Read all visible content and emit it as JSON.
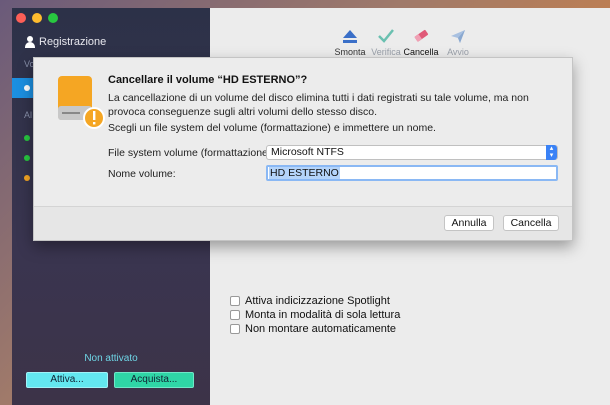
{
  "sidebar": {
    "registration_label": "Registrazione",
    "section_volumes": "Vo",
    "section_other": "Al",
    "status_text": "Non attivato",
    "activate_label": "Attiva...",
    "buy_label": "Acquista...",
    "dot_colors": [
      "#28c840",
      "#28c840",
      "#f5a623"
    ]
  },
  "toolbar": {
    "unmount_label": "Smonta",
    "verify_label": "Verifica",
    "erase_label": "Cancella",
    "launch_label": "Avvio"
  },
  "options": {
    "spotlight_label": "Attiva indicizzazione Spotlight",
    "readonly_label": "Monta in modalità di sola lettura",
    "nomount_label": "Non montare automaticamente"
  },
  "sheet": {
    "title": "Cancellare il volume “HD ESTERNO”?",
    "description": "La cancellazione di un volume del disco elimina tutti i dati registrati su tale volume, ma non provoca conseguenze sugli altri volumi dello stesso disco.",
    "subtitle": "Scegli un file system del volume (formattazione) e immettere un nome.",
    "fs_label": "File system volume (formattazione):",
    "fs_value": "Microsoft NTFS",
    "name_label": "Nome volume:",
    "name_value": "HD ESTERNO",
    "cancel_label": "Annulla",
    "erase_label": "Cancella"
  },
  "colors": {
    "accent": "#3a82f6",
    "selection": "#1c8fe0",
    "activate": "#63e8f0",
    "buy": "#2fd6a6"
  }
}
